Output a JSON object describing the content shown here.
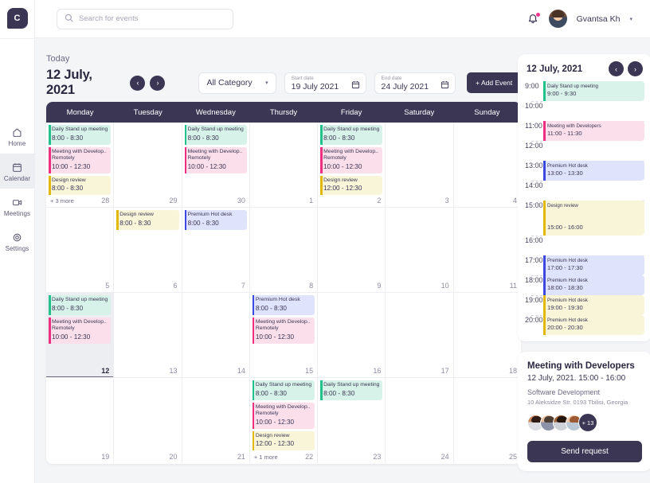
{
  "app": {
    "logo_text": "C"
  },
  "search": {
    "placeholder": "Search for events",
    "value": "",
    "icon": "search-icon"
  },
  "header": {
    "notification_icon": "bell-icon",
    "has_notification": true,
    "username": "Gvantsa Kh",
    "caret": "▾"
  },
  "sidebar": {
    "items": [
      {
        "label": "Home",
        "icon": "home-icon",
        "active": false
      },
      {
        "label": "Calendar",
        "icon": "calendar-icon",
        "active": true
      },
      {
        "label": "Meetings",
        "icon": "video-camera-icon",
        "active": false
      },
      {
        "label": "Settings",
        "icon": "gear-icon",
        "active": false
      }
    ]
  },
  "toolbar": {
    "today_label": "Today",
    "current_date": "12 July, 2021",
    "prev_icon": "‹",
    "next_icon": "›",
    "category": {
      "label": "All Category",
      "caret": "▾"
    },
    "start_date": {
      "label": "Start date",
      "value": "19 July 2021",
      "icon": "calendar-icon"
    },
    "end_date": {
      "label": "End date",
      "value": "24 July 2021",
      "icon": "calendar-icon"
    },
    "add_event_label": "+ Add Event"
  },
  "calendar": {
    "weekdays": [
      "Monday",
      "Tuesday",
      "Wednesday",
      "Thursdy",
      "Friday",
      "Saturday",
      "Sunday"
    ],
    "weeks": [
      {
        "days": [
          {
            "num": "28",
            "today": false,
            "more": "+ 3 more",
            "events": [
              {
                "title": "Daily Stand up meeting",
                "time": "8:00 - 8:30",
                "color": "green"
              },
              {
                "title": "Meeting with Develop.. Remotely",
                "time": "10:00 - 12:30",
                "color": "pink"
              },
              {
                "title": "Design review",
                "time": "8:00 - 8:30",
                "color": "yellow"
              }
            ]
          },
          {
            "num": "29",
            "today": false,
            "more": "",
            "events": []
          },
          {
            "num": "30",
            "today": false,
            "more": "",
            "events": [
              {
                "title": "Daily Stand up meeting",
                "time": "8:00 - 8:30",
                "color": "green"
              },
              {
                "title": "Meeting with Develop.. Remotely",
                "time": "10:00 - 12:30",
                "color": "pink"
              }
            ]
          },
          {
            "num": "1",
            "today": false,
            "more": "",
            "events": []
          },
          {
            "num": "2",
            "today": false,
            "more": "",
            "events": [
              {
                "title": "Daily Stand up meeting",
                "time": "8:00 - 8:30",
                "color": "green"
              },
              {
                "title": "Meeting with Develop.. Remotely",
                "time": "10:00 - 12:30",
                "color": "pink"
              },
              {
                "title": "Design review",
                "time": "12:00 - 12:30",
                "color": "yellow"
              }
            ]
          },
          {
            "num": "3",
            "today": false,
            "more": "",
            "events": []
          },
          {
            "num": "4",
            "today": false,
            "more": "",
            "events": []
          }
        ]
      },
      {
        "days": [
          {
            "num": "5",
            "today": false,
            "more": "",
            "events": []
          },
          {
            "num": "6",
            "today": false,
            "more": "",
            "events": [
              {
                "title": "Design review",
                "time": "8:00 - 8:30",
                "color": "yellow"
              }
            ]
          },
          {
            "num": "7",
            "today": false,
            "more": "",
            "events": [
              {
                "title": "Premium Hot desk",
                "time": "8:00 - 8:30",
                "color": "blue"
              }
            ]
          },
          {
            "num": "8",
            "today": false,
            "more": "",
            "events": []
          },
          {
            "num": "9",
            "today": false,
            "more": "",
            "events": []
          },
          {
            "num": "10",
            "today": false,
            "more": "",
            "events": []
          },
          {
            "num": "11",
            "today": false,
            "more": "",
            "events": []
          }
        ]
      },
      {
        "days": [
          {
            "num": "12",
            "today": true,
            "more": "",
            "events": [
              {
                "title": "Daily Stand up meeting",
                "time": "8:00 - 8:30",
                "color": "green"
              },
              {
                "title": "Meeting with Develop.. Remotely",
                "time": "10:00 - 12:30",
                "color": "pink"
              }
            ]
          },
          {
            "num": "13",
            "today": false,
            "more": "",
            "events": []
          },
          {
            "num": "14",
            "today": false,
            "more": "",
            "events": []
          },
          {
            "num": "15",
            "today": false,
            "more": "",
            "events": [
              {
                "title": "Premium Hot desk",
                "time": "8:00 - 8:30",
                "color": "blue"
              },
              {
                "title": "Meeting with Develop.. Remotely",
                "time": "10:00 - 12:30",
                "color": "pink"
              }
            ]
          },
          {
            "num": "16",
            "today": false,
            "more": "",
            "events": []
          },
          {
            "num": "17",
            "today": false,
            "more": "",
            "events": []
          },
          {
            "num": "18",
            "today": false,
            "more": "",
            "events": []
          }
        ]
      },
      {
        "days": [
          {
            "num": "19",
            "today": false,
            "more": "",
            "events": []
          },
          {
            "num": "20",
            "today": false,
            "more": "",
            "events": []
          },
          {
            "num": "21",
            "today": false,
            "more": "",
            "events": []
          },
          {
            "num": "22",
            "today": false,
            "more": "+ 1 more",
            "events": [
              {
                "title": "Daily Stand up meeting",
                "time": "8:00 - 8:30",
                "color": "green"
              },
              {
                "title": "Meeting with Develop.. Remotely",
                "time": "10:00 - 12:30",
                "color": "pink"
              },
              {
                "title": "Design review",
                "time": "12:00 - 12:30",
                "color": "yellow"
              }
            ]
          },
          {
            "num": "23",
            "today": false,
            "more": "",
            "events": [
              {
                "title": "Daily Stand up meeting",
                "time": "8:00 - 8:30",
                "color": "green"
              }
            ]
          },
          {
            "num": "24",
            "today": false,
            "more": "",
            "events": []
          },
          {
            "num": "25",
            "today": false,
            "more": "",
            "events": []
          }
        ]
      }
    ]
  },
  "day_panel": {
    "title": "12 July, 2021",
    "prev_icon": "‹",
    "next_icon": "›",
    "rows": [
      {
        "time": "9:00",
        "sep": "none",
        "event": {
          "title": "Daily Stand up meeting",
          "time": "9:00 - 9:30",
          "color": "green",
          "tall": false
        }
      },
      {
        "time": "10:00",
        "sep": "short",
        "event": null
      },
      {
        "time": "11:00",
        "sep": "full",
        "event": {
          "title": "Meeting with Developers",
          "time": "11:00 - 11:30",
          "color": "pink",
          "tall": false
        }
      },
      {
        "time": "12:00",
        "sep": "short",
        "event": null
      },
      {
        "time": "13:00",
        "sep": "full",
        "event": {
          "title": "Premium Hot desk",
          "time": "13:00 - 13:30",
          "color": "blue",
          "tall": false
        }
      },
      {
        "time": "14:00",
        "sep": "short",
        "event": null
      },
      {
        "time": "15:00",
        "sep": "full",
        "event": {
          "title": "Design review",
          "time": "15:00 - 16:00",
          "color": "yellow",
          "tall": true
        }
      },
      {
        "time": "16:00",
        "sep": "short",
        "event": null
      },
      {
        "time": "17:00",
        "sep": "full",
        "event": {
          "title": "Premium Hot desk",
          "time": "17:00 - 17:30",
          "color": "blue",
          "tall": false
        }
      },
      {
        "time": "18:00",
        "sep": "short",
        "event": {
          "title": "Premium Hot desk",
          "time": "18:00 - 18:30",
          "color": "blue",
          "tall": false
        }
      },
      {
        "time": "19:00",
        "sep": "short",
        "event": {
          "title": "Premium Hot desk",
          "time": "19:00 - 19:30",
          "color": "yellow",
          "tall": false
        }
      },
      {
        "time": "20:00",
        "sep": "short",
        "event": {
          "title": "Premium Hot desk",
          "time": "20:00 - 20:30",
          "color": "yellow",
          "tall": false
        }
      }
    ]
  },
  "detail": {
    "title": "Meeting with Developers",
    "when": "12 July, 2021.  15:00 - 16:00",
    "organization": "Software Development",
    "address": "10 Aleksidze Str. 0193 Tbilisi, Georgia",
    "attendee_count_more": "+ 13",
    "send_request_label": "Send request"
  },
  "colors": {
    "brand_dark": "#3b3654",
    "page_bg": "#f4f5f7",
    "green": "#22c08a",
    "pink": "#ec2f7e",
    "yellow": "#e3b80c",
    "blue": "#3b49e0",
    "notification_dot": "#f2378f"
  }
}
